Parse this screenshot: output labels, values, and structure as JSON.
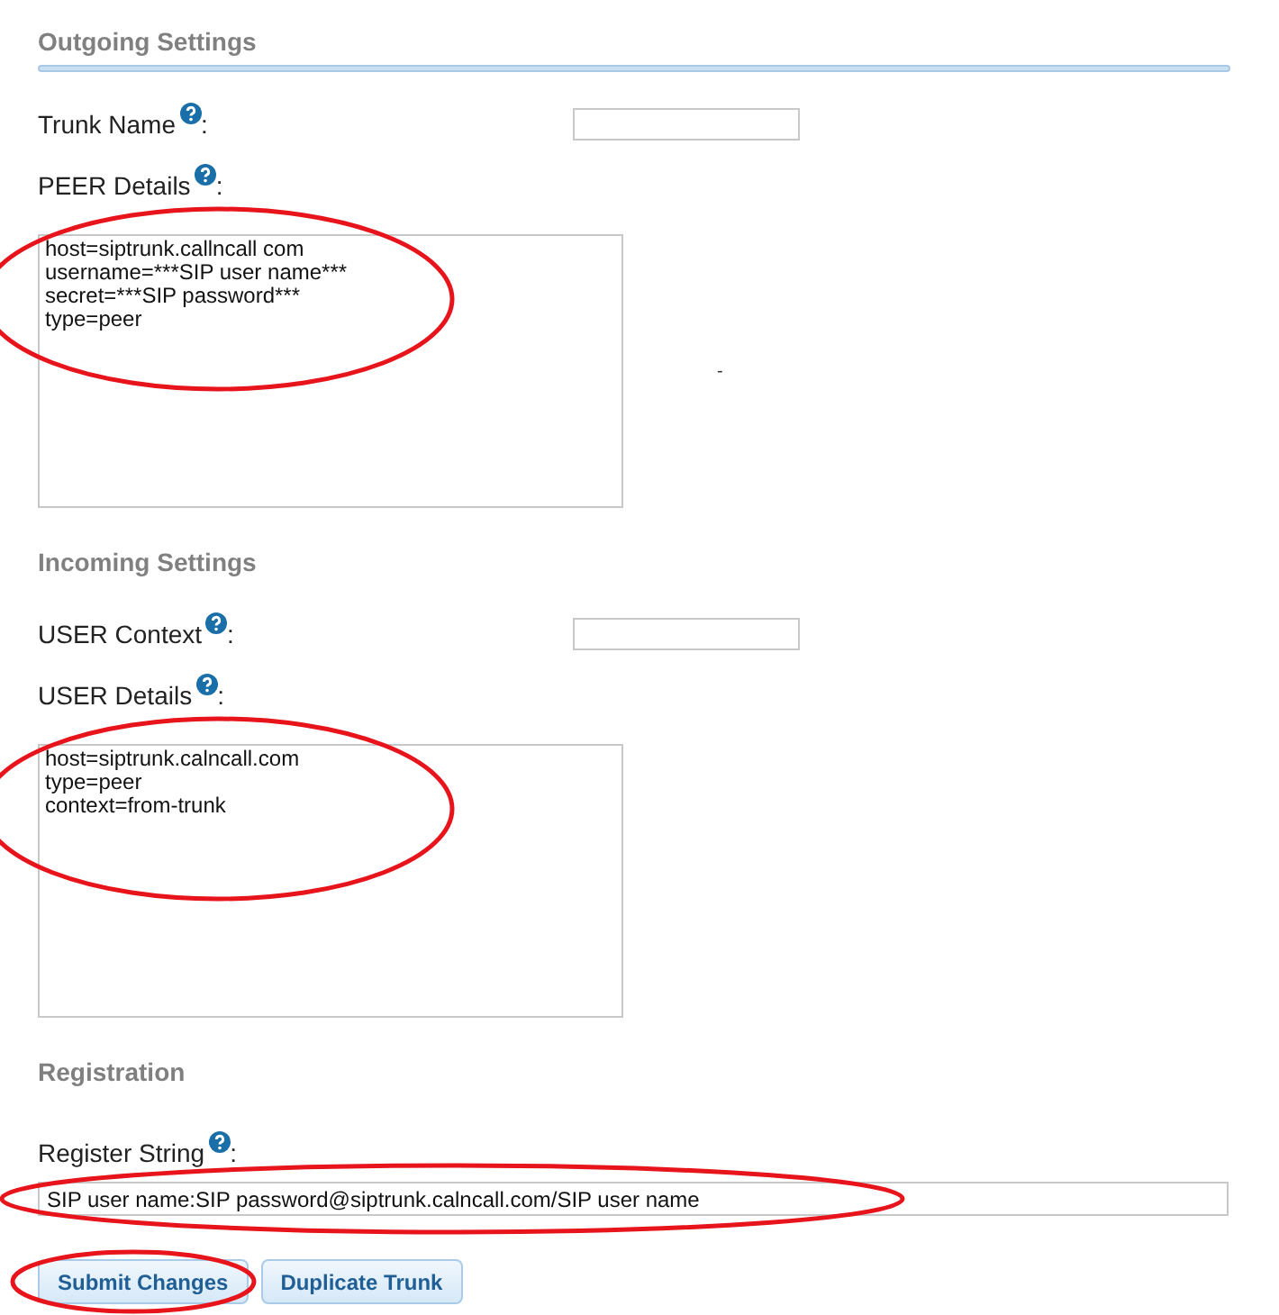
{
  "sections": [
    {
      "heading": "Outgoing Settings",
      "underline": true,
      "fields": [
        {
          "kind": "short",
          "label": "Trunk Name",
          "help": true,
          "colon": ":"
        },
        {
          "kind": "area",
          "label": "PEER Details",
          "help": true,
          "colon": ":",
          "circled": true,
          "value": "host=siptrunk.callncall com\nusername=***SIP user name***\nsecret=***SIP password***\ntype=peer",
          "side_mark": "-"
        }
      ]
    },
    {
      "heading": "Incoming Settings",
      "underline": false,
      "fields": [
        {
          "kind": "short",
          "label": "USER Context",
          "help": true,
          "colon": ":"
        },
        {
          "kind": "area",
          "label": "USER Details",
          "help": true,
          "colon": ":",
          "circled": true,
          "value": "host=siptrunk.calncall.com\ntype=peer\ncontext=from-trunk"
        }
      ]
    },
    {
      "heading": "Registration",
      "underline": false,
      "fields": [
        {
          "kind": "wide",
          "label": "Register String",
          "help": true,
          "colon": ":",
          "circled": true,
          "value": "SIP user name:SIP password@siptrunk.calncall.com/SIP user name"
        }
      ]
    }
  ],
  "buttons": [
    {
      "label": "Submit Changes",
      "circled": true
    },
    {
      "label": "Duplicate Trunk",
      "circled": false
    }
  ]
}
